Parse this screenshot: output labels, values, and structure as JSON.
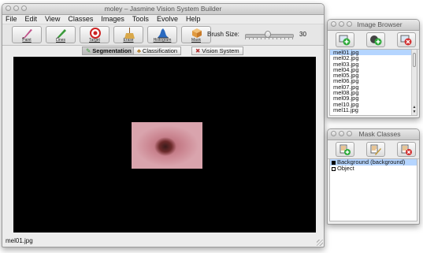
{
  "main_window": {
    "title": "moley – Jasmine Vision System Builder",
    "menu": [
      "File",
      "Edit",
      "View",
      "Classes",
      "Images",
      "Tools",
      "Evolve",
      "Help"
    ],
    "tools": [
      {
        "label": "Paint",
        "icon": "paintbrush-icon"
      },
      {
        "label": "Lines",
        "icon": "pencil-icon"
      },
      {
        "label": "Target",
        "icon": "target-icon"
      },
      {
        "label": "Erase",
        "icon": "broom-icon"
      },
      {
        "label": "Histogram",
        "icon": "histogram-icon"
      },
      {
        "label": "Mask",
        "icon": "box-icon"
      }
    ],
    "brush": {
      "label": "Brush Size:",
      "value": "30",
      "fraction": 0.48
    },
    "tabs": [
      {
        "label": "Segmentation",
        "icon": "pencil-icon",
        "active": true
      },
      {
        "label": "Classification",
        "icon": "puzzle-icon",
        "active": false
      },
      {
        "label": "Vision System",
        "icon": "tools-icon",
        "active": false
      }
    ],
    "status": "mel01.jpg"
  },
  "image_browser": {
    "title": "Image Browser",
    "buttons": [
      "add-image-icon",
      "add-images-icon",
      "remove-image-icon"
    ],
    "files": [
      "mel01.jpg",
      "mel02.jpg",
      "mel03.jpg",
      "mel04.jpg",
      "mel05.jpg",
      "mel06.jpg",
      "mel07.jpg",
      "mel08.jpg",
      "mel09.jpg",
      "mel10.jpg",
      "mel11.jpg"
    ],
    "selected": "mel01.jpg"
  },
  "mask_classes": {
    "title": "Mask Classes",
    "buttons": [
      "add-class-icon",
      "edit-class-icon",
      "remove-class-icon"
    ],
    "classes": [
      {
        "label": "Background (background)",
        "color": "#000000",
        "selected": true
      },
      {
        "label": "Object",
        "color": "#ffffff",
        "selected": false
      }
    ]
  },
  "colors": {
    "selection": "#b5d5ff",
    "canvas": "#000000"
  }
}
